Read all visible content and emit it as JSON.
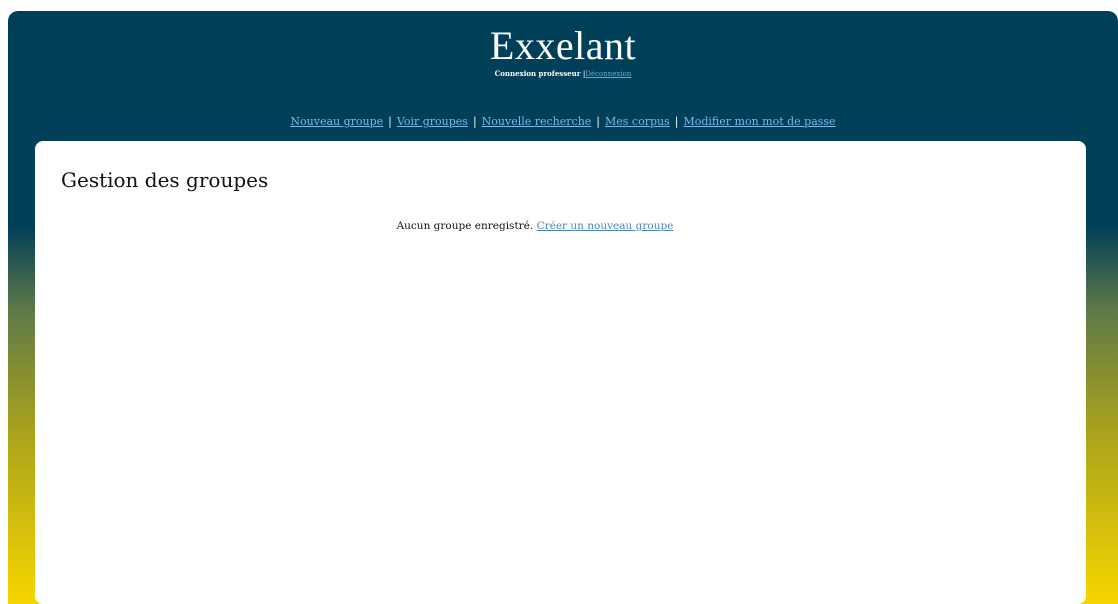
{
  "header": {
    "title": "Exxelant",
    "login_status": "Connexion professeur |",
    "logout_label": "Déconnexion"
  },
  "nav": {
    "items": [
      {
        "label": "Nouveau groupe"
      },
      {
        "label": "Voir groupes"
      },
      {
        "label": "Nouvelle recherche"
      },
      {
        "label": "Mes corpus"
      },
      {
        "label": "Modifier mon mot de passe"
      }
    ],
    "separator": "|"
  },
  "main": {
    "title": "Gestion des groupes",
    "empty_message": "Aucun groupe enregistré.",
    "create_link": "Créer un nouveau groupe"
  },
  "colors": {
    "header_bg": "#003f58",
    "gradient_bottom": "#f6d600",
    "link": "#7db8e6"
  }
}
